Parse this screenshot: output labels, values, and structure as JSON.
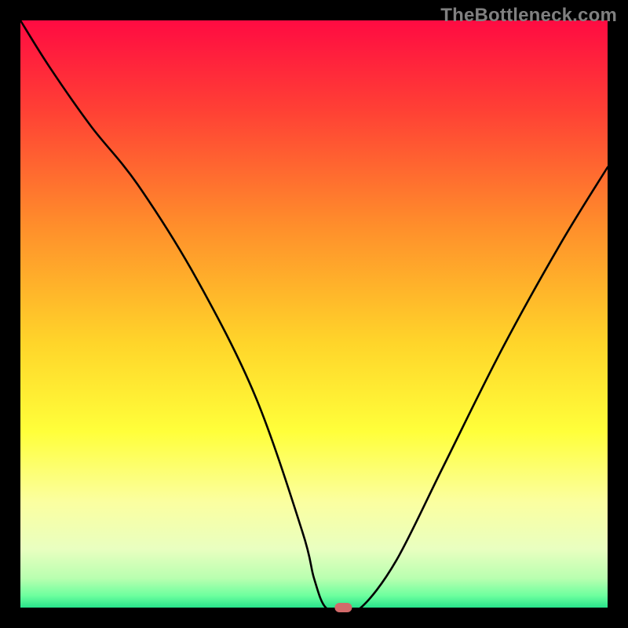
{
  "watermark": "TheBottleneck.com",
  "chart_data": {
    "type": "line",
    "title": "",
    "xlabel": "",
    "ylabel": "",
    "xlim": [
      0,
      100
    ],
    "ylim": [
      0,
      100
    ],
    "grid": false,
    "legend": false,
    "description": "Bottleneck percentage curve over a vertical rainbow gradient (red at top through yellow to green at bottom). Curve is a V-shape with its minimum near x≈55 touching y≈0 (green zone).",
    "gradient_stops": [
      {
        "pct": 0,
        "color": "#ff0b42"
      },
      {
        "pct": 15,
        "color": "#ff3f35"
      },
      {
        "pct": 35,
        "color": "#ff8e2b"
      },
      {
        "pct": 55,
        "color": "#ffd52a"
      },
      {
        "pct": 70,
        "color": "#ffff3a"
      },
      {
        "pct": 82,
        "color": "#fbffa0"
      },
      {
        "pct": 90,
        "color": "#e9ffc0"
      },
      {
        "pct": 95,
        "color": "#b9ffb0"
      },
      {
        "pct": 98,
        "color": "#6cff9e"
      },
      {
        "pct": 100,
        "color": "#28e38b"
      }
    ],
    "series": [
      {
        "name": "bottleneck-curve",
        "x": [
          0,
          5,
          12,
          20,
          30,
          40,
          48,
          50,
          52,
          55,
          58,
          64,
          72,
          82,
          92,
          100
        ],
        "values": [
          100,
          92,
          82,
          72,
          56,
          36,
          13,
          5,
          0,
          0,
          0,
          8,
          24,
          44,
          62,
          75
        ]
      }
    ],
    "marker": {
      "x": 55,
      "y": 0,
      "color": "#d26a6a"
    }
  }
}
